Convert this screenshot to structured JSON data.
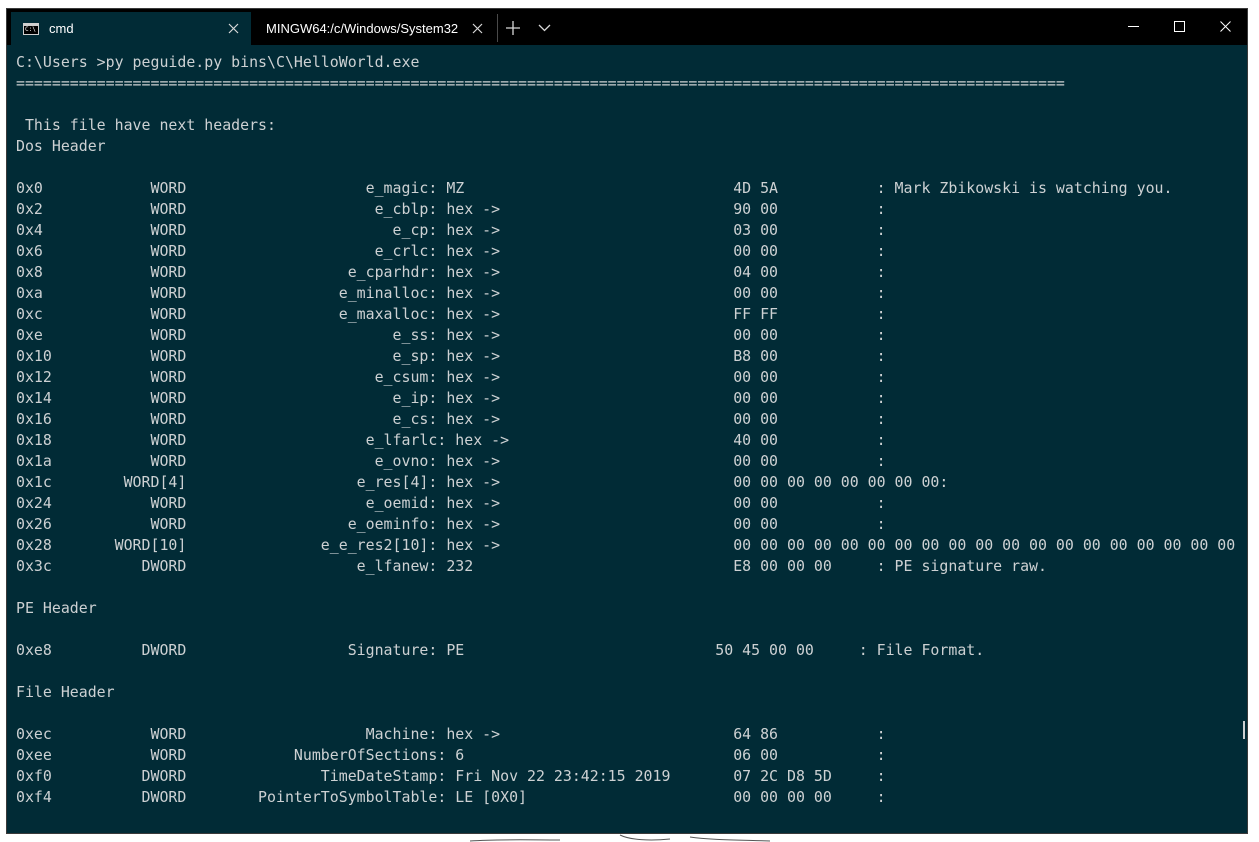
{
  "window": {
    "tabs": [
      {
        "label": "cmd",
        "icon": "cmd-icon",
        "active": true
      },
      {
        "label": "MINGW64:/c/Windows/System32",
        "active": false
      }
    ],
    "tab_icon_text": "C:\\",
    "colors": {
      "console_bg": "#012b36",
      "console_text": "#cdd1d3",
      "titlebar_bg": "#000000"
    }
  },
  "console": {
    "lines": [
      "C:\\Users >py peguide.py bins\\C\\HelloWorld.exe",
      "=====================================================================================================================",
      "",
      " This file have next headers:",
      "Dos Header",
      "",
      "0x0            WORD                    e_magic: MZ                              4D 5A           : Mark Zbikowski is watching you.",
      "0x2            WORD                     e_cblp: hex ->                          90 00           :",
      "0x4            WORD                       e_cp: hex ->                          03 00           :",
      "0x6            WORD                     e_crlc: hex ->                          00 00           :",
      "0x8            WORD                  e_cparhdr: hex ->                          04 00           :",
      "0xa            WORD                 e_minalloc: hex ->                          00 00           :",
      "0xc            WORD                 e_maxalloc: hex ->                          FF FF           :",
      "0xe            WORD                       e_ss: hex ->                          00 00           :",
      "0x10           WORD                       e_sp: hex ->                          B8 00           :",
      "0x12           WORD                     e_csum: hex ->                          00 00           :",
      "0x14           WORD                       e_ip: hex ->                          00 00           :",
      "0x16           WORD                       e_cs: hex ->                          00 00           :",
      "0x18           WORD                    e_lfarlc: hex ->                         40 00           :",
      "0x1a           WORD                     e_ovno: hex ->                          00 00           :",
      "0x1c        WORD[4]                   e_res[4]: hex ->                          00 00 00 00 00 00 00 00:",
      "0x24           WORD                    e_oemid: hex ->                          00 00           :",
      "0x26           WORD                  e_oeminfo: hex ->                          00 00           :",
      "0x28       WORD[10]               e_e_res2[10]: hex ->                          00 00 00 00 00 00 00 00 00 00 00 00 00 00 00 00 00 00 00 00",
      "0x3c          DWORD                   e_lfanew: 232                             E8 00 00 00     : PE signature raw.",
      "",
      "PE Header",
      "",
      "0xe8          DWORD                  Signature: PE                            50 45 00 00     : File Format.",
      "",
      "File Header",
      "",
      "0xec           WORD                    Machine: hex ->                          64 86           :",
      "0xee           WORD            NumberOfSections: 6                              06 00           :",
      "0xf0          DWORD               TimeDateStamp: Fri Nov 22 23:42:15 2019       07 2C D8 5D     :",
      "0xf4          DWORD        PointerToSymbolTable: LE [0X0]                       00 00 00 00     :"
    ]
  }
}
